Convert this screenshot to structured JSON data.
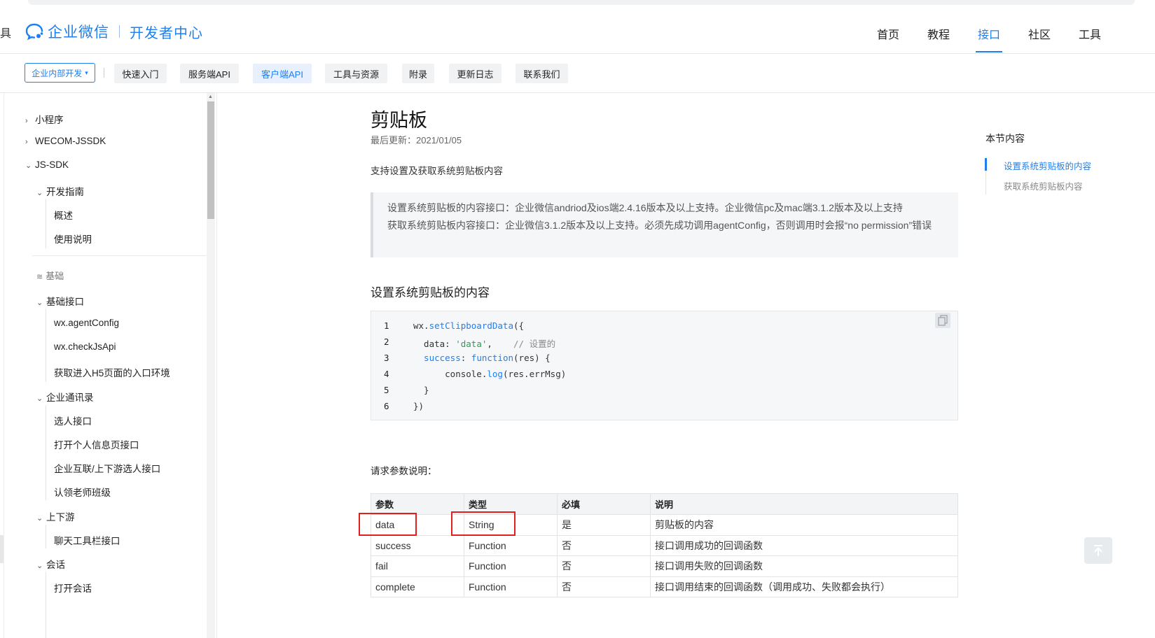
{
  "header": {
    "edge_glyph": "具",
    "brand": "企业微信",
    "sub": "开发者中心",
    "nav": [
      {
        "label": "首页"
      },
      {
        "label": "教程"
      },
      {
        "label": "接口",
        "active": true
      },
      {
        "label": "社区"
      },
      {
        "label": "工具"
      }
    ]
  },
  "subnav": {
    "dropdown": "企业内部开发",
    "tabs": [
      {
        "label": "快速入门"
      },
      {
        "label": "服务端API"
      },
      {
        "label": "客户端API",
        "active": true
      },
      {
        "label": "工具与资源"
      },
      {
        "label": "附录"
      },
      {
        "label": "更新日志"
      },
      {
        "label": "联系我们"
      }
    ]
  },
  "sidebar": {
    "items": [
      {
        "label": "小程序",
        "arrow": "›"
      },
      {
        "label": "WECOM-JSSDK",
        "arrow": "›"
      },
      {
        "label": "JS-SDK",
        "arrow": "⌄"
      },
      {
        "label": "开发指南",
        "arrow": "⌄"
      },
      {
        "label": "概述"
      },
      {
        "label": "使用说明"
      },
      {
        "label": "基础"
      },
      {
        "label": "基础接口",
        "arrow": "⌄"
      },
      {
        "label": "wx.agentConfig"
      },
      {
        "label": "wx.checkJsApi"
      },
      {
        "label": "获取进入H5页面的入口环境"
      },
      {
        "label": "企业通讯录",
        "arrow": "⌄"
      },
      {
        "label": "选人接口"
      },
      {
        "label": "打开个人信息页接口"
      },
      {
        "label": "企业互联/上下游选人接口"
      },
      {
        "label": "认领老师班级"
      },
      {
        "label": "上下游",
        "arrow": "⌄"
      },
      {
        "label": "聊天工具栏接口"
      },
      {
        "label": "会话",
        "arrow": "⌄"
      },
      {
        "label": "打开会话"
      }
    ]
  },
  "doc": {
    "title": "剪贴板",
    "updated": "最后更新：2021/01/05",
    "intro": "支持设置及获取系统剪贴板内容",
    "note_line1": "设置系统剪贴板的内容接口：企业微信andriod及ios端2.4.16版本及以上支持。企业微信pc及mac端3.1.2版本及以上支持",
    "note_line2": "获取系统剪贴板内容接口：企业微信3.1.2版本及以上支持。必须先成功调用agentConfig，否则调用时会报“no permission”错误",
    "section": "设置系统剪贴板的内容",
    "code": {
      "lines": [
        "1",
        "2",
        "3",
        "4",
        "5",
        "6"
      ],
      "l1_a": "wx.",
      "l1_fn": "setClipboardData",
      "l1_b": "({",
      "l2_a": "  data: ",
      "l2_str": "'data'",
      "l2_b": ",    ",
      "l2_cm": "// 设置的",
      "l3_kw": "  success",
      "l3_a": ": ",
      "l3_fn": "function",
      "l3_b": "(res) {",
      "l4_a": "      console.",
      "l4_fn": "log",
      "l4_b": "(res.errMsg)",
      "l5": "  }",
      "l6": "})"
    },
    "params_heading": "请求参数说明：",
    "table": {
      "headers": [
        "参数",
        "类型",
        "必填",
        "说明"
      ],
      "rows": [
        [
          "data",
          "String",
          "是",
          "剪贴板的内容"
        ],
        [
          "success",
          "Function",
          "否",
          "接口调用成功的回调函数"
        ],
        [
          "fail",
          "Function",
          "否",
          "接口调用失败的回调函数"
        ],
        [
          "complete",
          "Function",
          "否",
          "接口调用结束的回调函数（调用成功、失败都会执行）"
        ]
      ]
    }
  },
  "toc": {
    "title": "本节内容",
    "items": [
      {
        "label": "设置系统剪贴板的内容",
        "active": true
      },
      {
        "label": "获取系统剪贴板内容"
      }
    ]
  },
  "colors": {
    "accent": "#1f7ff1",
    "highlight_box": "#e02020"
  }
}
